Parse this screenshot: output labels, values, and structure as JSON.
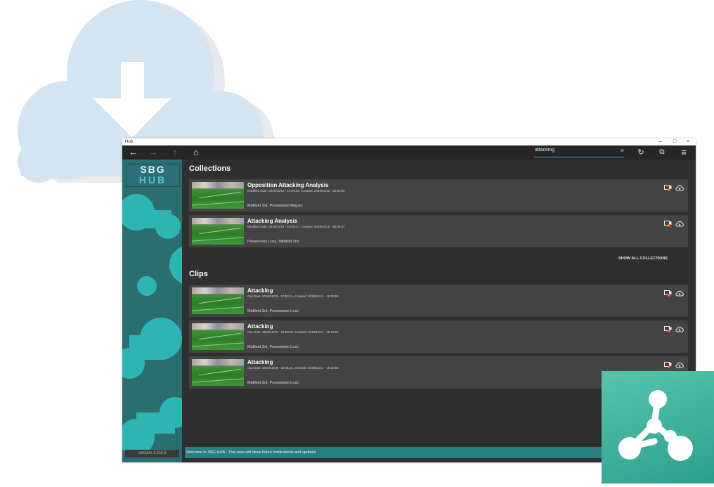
{
  "window": {
    "title": "Hub",
    "controls": [
      "–",
      "□",
      "×"
    ]
  },
  "toolbar": {
    "back": "←",
    "forward": "→",
    "up": "↑",
    "home": "⌂",
    "search_value": "attacking",
    "clear": "×",
    "refresh": "↻",
    "open_external": "⧉",
    "menu": "≡"
  },
  "sidebar": {
    "logo_top": "SBG",
    "logo_bottom": "HUB",
    "version": "Version 1.0.0.5"
  },
  "collections": {
    "heading": "Collections",
    "show_all": "SHOW ALL COLLECTIONS",
    "items": [
      {
        "title": "Opposition Attacking Analysis",
        "meta": "Modified Date: 2019/11/12 - 16:29:54, Created: 2019/11/12 - 16:29:54",
        "tags": "Midfield 3rd, Possession Regain",
        "badge": "2"
      },
      {
        "title": "Attacking Analysis",
        "meta": "Modified Date: 2019/11/12 - 16:29:47, Created: 2019/11/12 - 16:29:47",
        "tags": "Possession Loss, Midfield 3rd",
        "badge": "2"
      }
    ]
  },
  "clips": {
    "heading": "Clips",
    "items": [
      {
        "title": "Attacking",
        "meta": "Clip Date: 2019/10/29 - 13:53:14, Created: 2019/11/12 - 16:22:56",
        "tags": "Midfield 3rd, Possession Loss",
        "badge": "1"
      },
      {
        "title": "Attacking",
        "meta": "Clip Date: 2019/10/29 - 13:50:06, Created: 2019/11/12 - 16:22:56",
        "tags": "Midfield 3rd, Possession Loss",
        "badge": "1"
      },
      {
        "title": "Attacking",
        "meta": "Clip Date: 2019/10/29 - 13:45:20, Created: 2019/11/12 - 16:22:56",
        "tags": "Midfield 3rd, Possession Loss",
        "badge": "1"
      }
    ]
  },
  "notification": "Welcome to SBG HUB - This area will show future notifications and updates",
  "colors": {
    "accent": "#2a7f80",
    "sidebar": "#2a6e70",
    "badge": "#e06a2e",
    "brand": "#3bb39c"
  },
  "icons": [
    "back-arrow-icon",
    "forward-arrow-icon",
    "up-arrow-icon",
    "home-icon",
    "refresh-icon",
    "open-external-icon",
    "menu-icon",
    "video-icon",
    "cloud-download-icon",
    "network-logo-icon"
  ]
}
